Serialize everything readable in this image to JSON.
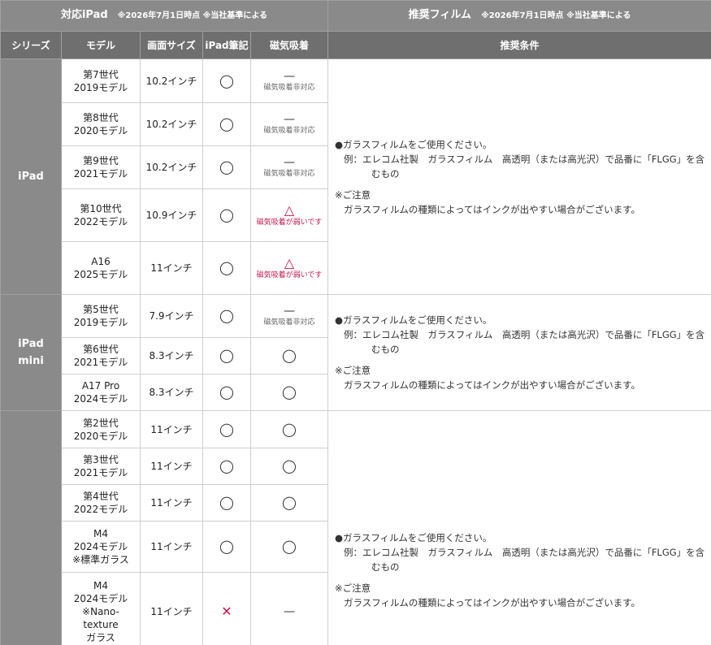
{
  "header": {
    "left_title": "対応iPad",
    "left_note": "※2026年7月1日時点 ※当社基準による",
    "right_title": "推奨フィルム",
    "right_note": "※2026年7月1日時点 ※当社基準による"
  },
  "columns": {
    "series": "シリーズ",
    "model": "モデル",
    "size": "画面サイズ",
    "pencil": "iPad筆記",
    "magnet": "磁気吸着",
    "condition": "推奨条件"
  },
  "symbols": {
    "circle": "◯",
    "dash": "—",
    "triangle": "△",
    "cross": "✕",
    "no_magnet": "磁気吸着非対応",
    "weak_magnet": "磁気吸着が弱いです"
  },
  "condition": {
    "line1": "●ガラスフィルムをご使用ください。",
    "line2": "例：エレコム社製　ガラスフィルム　高透明（または高光沢）で品番に「FLGG」を含",
    "line3": "むもの",
    "line4": "※ご注意",
    "line5": "ガラスフィルムの種類によってはインクが出やすい場合がございます。"
  },
  "groups": [
    {
      "series": [
        "iPad"
      ],
      "rows": [
        {
          "model": [
            "第7世代",
            "2019モデル"
          ],
          "size": "10.2インチ"
        },
        {
          "model": [
            "第8世代",
            "2020モデル"
          ],
          "size": "10.2インチ"
        },
        {
          "model": [
            "第9世代",
            "2021モデル"
          ],
          "size": "10.2インチ"
        },
        {
          "model": [
            "第10世代",
            "2022モデル"
          ],
          "size": "10.9インチ"
        },
        {
          "model": [
            "A16",
            "2025モデル"
          ],
          "size": "11インチ"
        }
      ]
    },
    {
      "series": [
        "iPad",
        "mini"
      ],
      "rows": [
        {
          "model": [
            "第5世代",
            "2019モデル"
          ],
          "size": "7.9インチ"
        },
        {
          "model": [
            "第6世代",
            "2021モデル"
          ],
          "size": "8.3インチ"
        },
        {
          "model": [
            "A17 Pro",
            "2024モデル"
          ],
          "size": "8.3インチ"
        }
      ]
    },
    {
      "series": [],
      "rows": [
        {
          "model": [
            "第2世代",
            "2020モデル"
          ],
          "size": "11インチ"
        },
        {
          "model": [
            "第3世代",
            "2021モデル"
          ],
          "size": "11インチ"
        },
        {
          "model": [
            "第4世代",
            "2022モデル"
          ],
          "size": "11インチ"
        },
        {
          "model": [
            "M4",
            "2024モデル",
            "※標準ガラス"
          ],
          "size": "11インチ"
        },
        {
          "model": [
            "M4",
            "2024モデル",
            "※Nano-",
            "texture",
            "ガラス"
          ],
          "size": "11インチ"
        }
      ]
    }
  ]
}
